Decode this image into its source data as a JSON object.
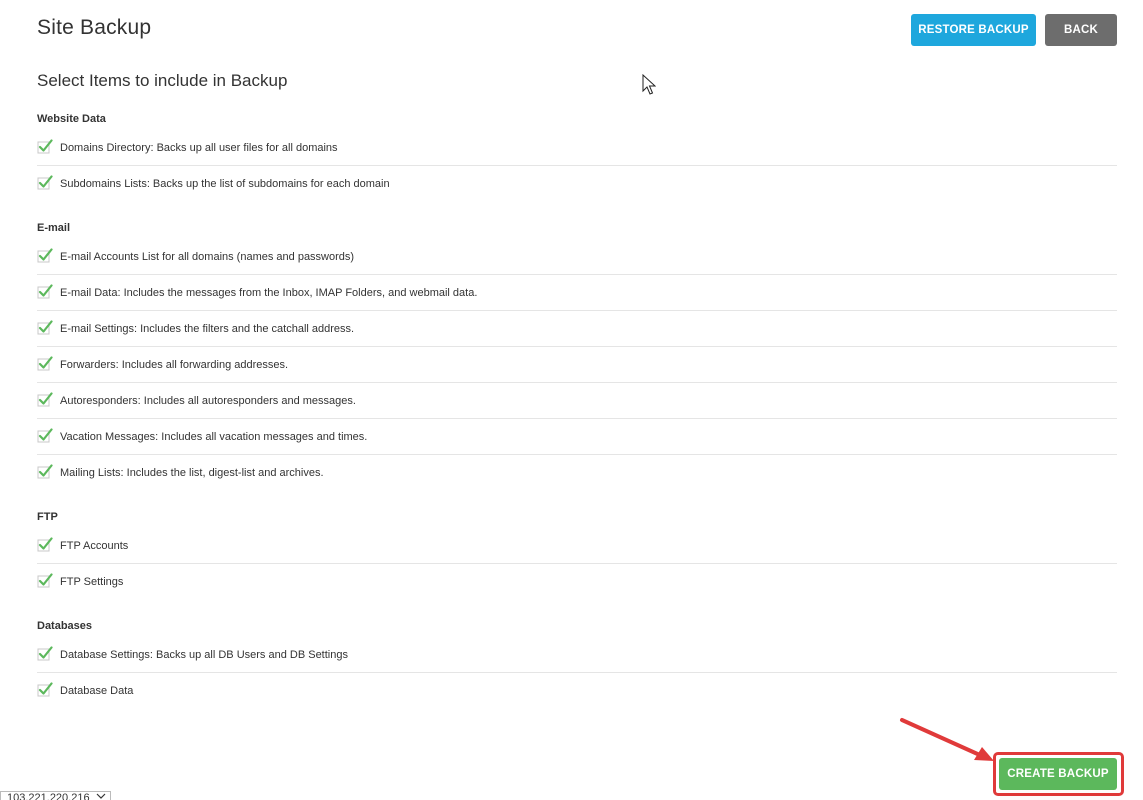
{
  "header": {
    "title": "Site Backup",
    "restore_label": "RESTORE BACKUP",
    "back_label": "BACK"
  },
  "main": {
    "heading": "Select Items to include in Backup",
    "groups": [
      {
        "title": "Website Data",
        "items": [
          {
            "label": "Domains Directory: Backs up all user files for all domains",
            "checked": true
          },
          {
            "label": "Subdomains Lists: Backs up the list of subdomains for each domain",
            "checked": true
          }
        ]
      },
      {
        "title": "E-mail",
        "items": [
          {
            "label": "E-mail Accounts List for all domains (names and passwords)",
            "checked": true
          },
          {
            "label": "E-mail Data: Includes the messages from the Inbox, IMAP Folders, and webmail data.",
            "checked": true
          },
          {
            "label": "E-mail Settings: Includes the filters and the catchall address.",
            "checked": true
          },
          {
            "label": "Forwarders: Includes all forwarding addresses.",
            "checked": true
          },
          {
            "label": "Autoresponders: Includes all autoresponders and messages.",
            "checked": true
          },
          {
            "label": "Vacation Messages: Includes all vacation messages and times.",
            "checked": true
          },
          {
            "label": "Mailing Lists: Includes the list, digest-list and archives.",
            "checked": true
          }
        ]
      },
      {
        "title": "FTP",
        "items": [
          {
            "label": "FTP Accounts",
            "checked": true
          },
          {
            "label": "FTP Settings",
            "checked": true
          }
        ]
      },
      {
        "title": "Databases",
        "items": [
          {
            "label": "Database Settings: Backs up all DB Users and DB Settings",
            "checked": true
          },
          {
            "label": "Database Data",
            "checked": true
          }
        ]
      }
    ]
  },
  "footer": {
    "create_label": "CREATE BACKUP",
    "ip_select_value": "103.221.220.216"
  },
  "colors": {
    "restore": "#1ea7dd",
    "back": "#6d6d6d",
    "create": "#5cb85c",
    "check": "#5cb85c",
    "highlight": "#e03a3a"
  }
}
